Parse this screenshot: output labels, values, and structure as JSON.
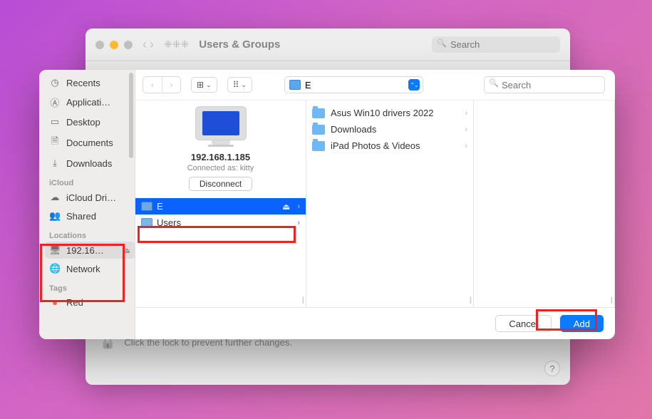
{
  "parent": {
    "title": "Users & Groups",
    "searchPlaceholder": "Search",
    "lockHint": "Click the lock to prevent further changes.",
    "helpLabel": "?"
  },
  "sidebar": {
    "items": [
      {
        "icon": "clock",
        "label": "Recents"
      },
      {
        "icon": "apps",
        "label": "Applicati…"
      },
      {
        "icon": "desktop",
        "label": "Desktop"
      },
      {
        "icon": "doc",
        "label": "Documents"
      },
      {
        "icon": "down",
        "label": "Downloads"
      }
    ],
    "icloudHeader": "iCloud",
    "icloudItems": [
      {
        "icon": "cloud",
        "label": "iCloud Dri…"
      },
      {
        "icon": "shared",
        "label": "Shared"
      }
    ],
    "locationsHeader": "Locations",
    "locationItems": [
      {
        "icon": "comp",
        "label": "192.16…",
        "eject": true
      },
      {
        "icon": "globe",
        "label": "Network"
      }
    ],
    "tagsHeader": "Tags",
    "tagItems": [
      {
        "color": "#ff5b56",
        "label": "Red"
      }
    ]
  },
  "toolbar": {
    "pathLabel": "E",
    "searchPlaceholder": "Search"
  },
  "server": {
    "name": "192.168.1.185",
    "connectedAs": "Connected as: kitty",
    "disconnect": "Disconnect",
    "volumes": [
      {
        "label": "E",
        "selected": true,
        "ejectable": true
      },
      {
        "label": "Users",
        "selected": false,
        "ejectable": false
      }
    ]
  },
  "col2": {
    "items": [
      {
        "label": "Asus Win10 drivers 2022"
      },
      {
        "label": "Downloads"
      },
      {
        "label": "iPad Photos & Videos"
      }
    ]
  },
  "footer": {
    "cancel": "Cancel",
    "add": "Add"
  }
}
